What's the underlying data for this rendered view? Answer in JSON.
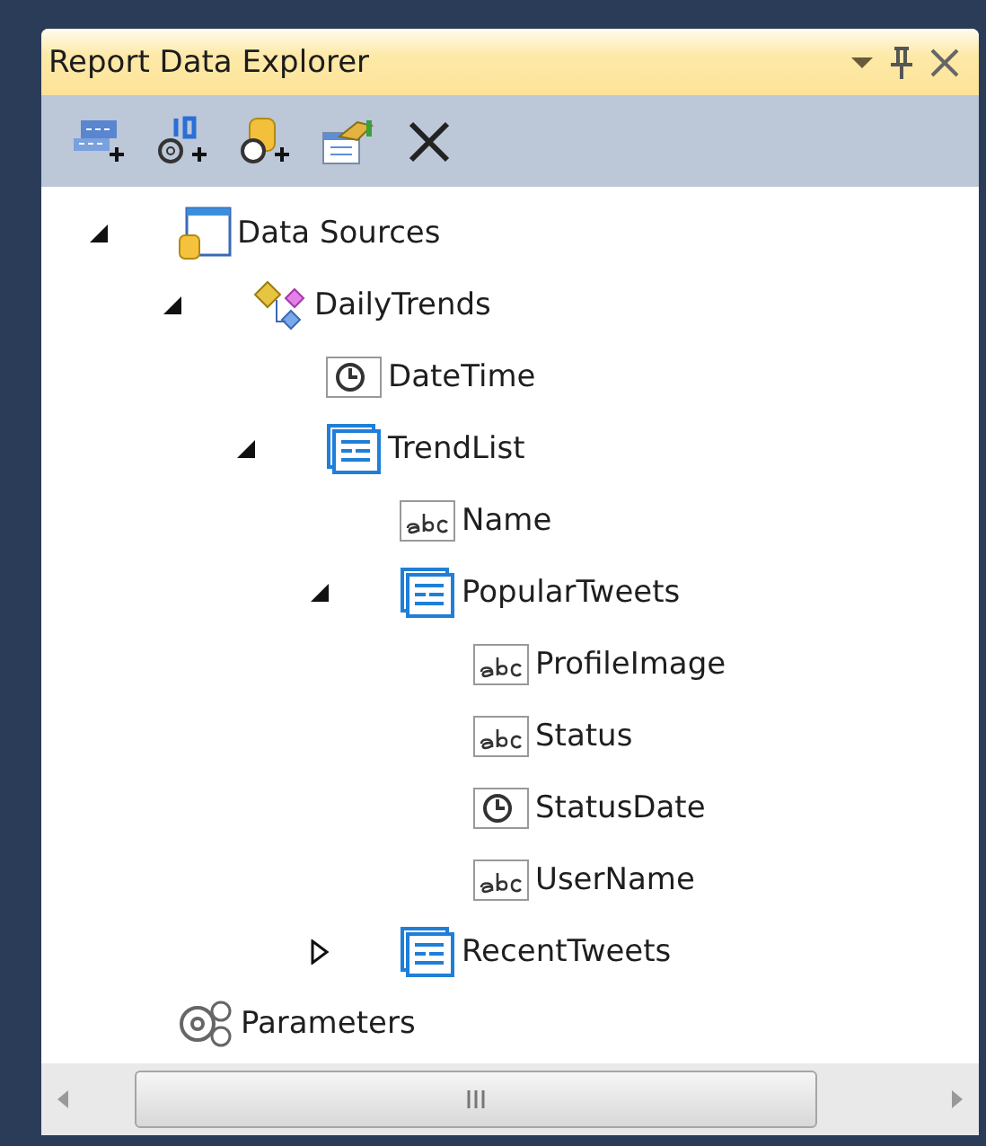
{
  "window": {
    "title": "Report Data Explorer"
  },
  "toolbar": {
    "buttons": [
      {
        "kind": "new-data"
      },
      {
        "kind": "new-parameter"
      },
      {
        "kind": "new-dataset"
      },
      {
        "kind": "edit"
      },
      {
        "kind": "delete"
      }
    ]
  },
  "tree": [
    {
      "label": "Data Sources",
      "kind": "datasources",
      "expanded": true,
      "children": [
        {
          "label": "DailyTrends",
          "kind": "dataset",
          "expanded": true,
          "children": [
            {
              "label": "DateTime",
              "kind": "date"
            },
            {
              "label": "TrendList",
              "kind": "list",
              "expanded": true,
              "children": [
                {
                  "label": "Name",
                  "kind": "text"
                },
                {
                  "label": "PopularTweets",
                  "kind": "list",
                  "expanded": true,
                  "children": [
                    {
                      "label": "ProfileImage",
                      "kind": "text"
                    },
                    {
                      "label": "Status",
                      "kind": "text"
                    },
                    {
                      "label": "StatusDate",
                      "kind": "date"
                    },
                    {
                      "label": "UserName",
                      "kind": "text"
                    }
                  ]
                },
                {
                  "label": "RecentTweets",
                  "kind": "list",
                  "expanded": false
                }
              ]
            }
          ]
        }
      ]
    },
    {
      "label": "Parameters",
      "kind": "parameters"
    }
  ]
}
